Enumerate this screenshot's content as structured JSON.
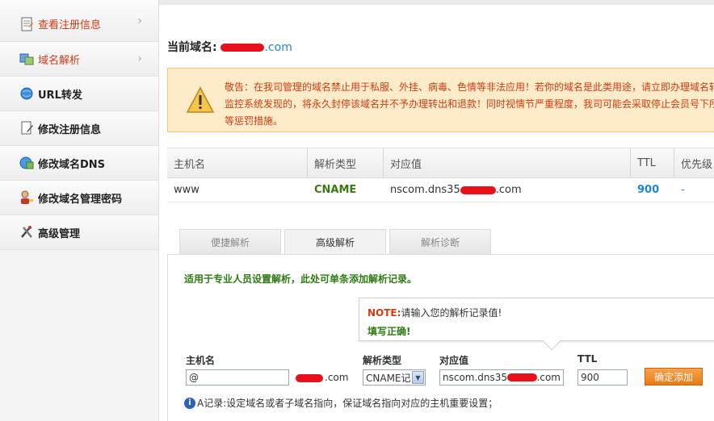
{
  "sidebar": {
    "items": [
      {
        "label": "查看注册信息",
        "icon": "document-icon"
      },
      {
        "label": "域名解析",
        "icon": "dns-icon"
      },
      {
        "label": "URL转发",
        "icon": "globe-icon"
      },
      {
        "label": "修改注册信息",
        "icon": "edit-icon"
      },
      {
        "label": "修改域名DNS",
        "icon": "dns-edit-icon"
      },
      {
        "label": "修改域名管理密码",
        "icon": "user-key-icon"
      },
      {
        "label": "高级管理",
        "icon": "tools-icon"
      }
    ],
    "chevron": "›"
  },
  "header": {
    "domain_label": "当前域名:",
    "domain_suffix": ".com"
  },
  "warning": {
    "text_line1": "敬告：在我司管理的域名禁止用于私服、外挂、病毒、色情等非法应用！若你的域名是此类用途，请立即办理域名转",
    "text_line2": "监控系统发现的，将永久封停该域名并不予办理转出和退款！同时视情节严重程度，我司可能会采取停止会员号下所",
    "text_line3": "等惩罚措施。"
  },
  "records": {
    "headers": [
      "主机名",
      "解析类型",
      "对应值",
      "TTL",
      "优先级"
    ],
    "rows": [
      {
        "host": "www",
        "type": "CNAME",
        "value_prefix": "nscom.dns35",
        "value_suffix": ".com",
        "ttl": "900",
        "priority": "-"
      }
    ]
  },
  "tabs": [
    "便捷解析",
    "高级解析",
    "解析诊断"
  ],
  "panel": {
    "intro": "适用于专业人员设置解析，此处可单条添加解析记录。",
    "tip": {
      "note_label": "NOTE:",
      "note_text": "请输入您的解析记录值!",
      "confirm": "填写正确!"
    },
    "form": {
      "host_label": "主机名",
      "host_value": "@",
      "host_suffix": ".com",
      "type_label": "解析类型",
      "type_value": "CNAME记",
      "value_label": "对应值",
      "value_prefix": "nscom.dns35",
      "value_suffix": ".com",
      "ttl_label": "TTL",
      "ttl_value": "900",
      "submit": "确定添加"
    },
    "note": "A记录:设定域名或者子域名指向，保证域名指向对应的主机重要设置；"
  },
  "colors": {
    "accent_red": "#d53a14",
    "link_blue": "#1f86d6",
    "green": "#2e7d12",
    "warn_bg": "#fdebc9",
    "button_orange": "#ea7a13"
  }
}
